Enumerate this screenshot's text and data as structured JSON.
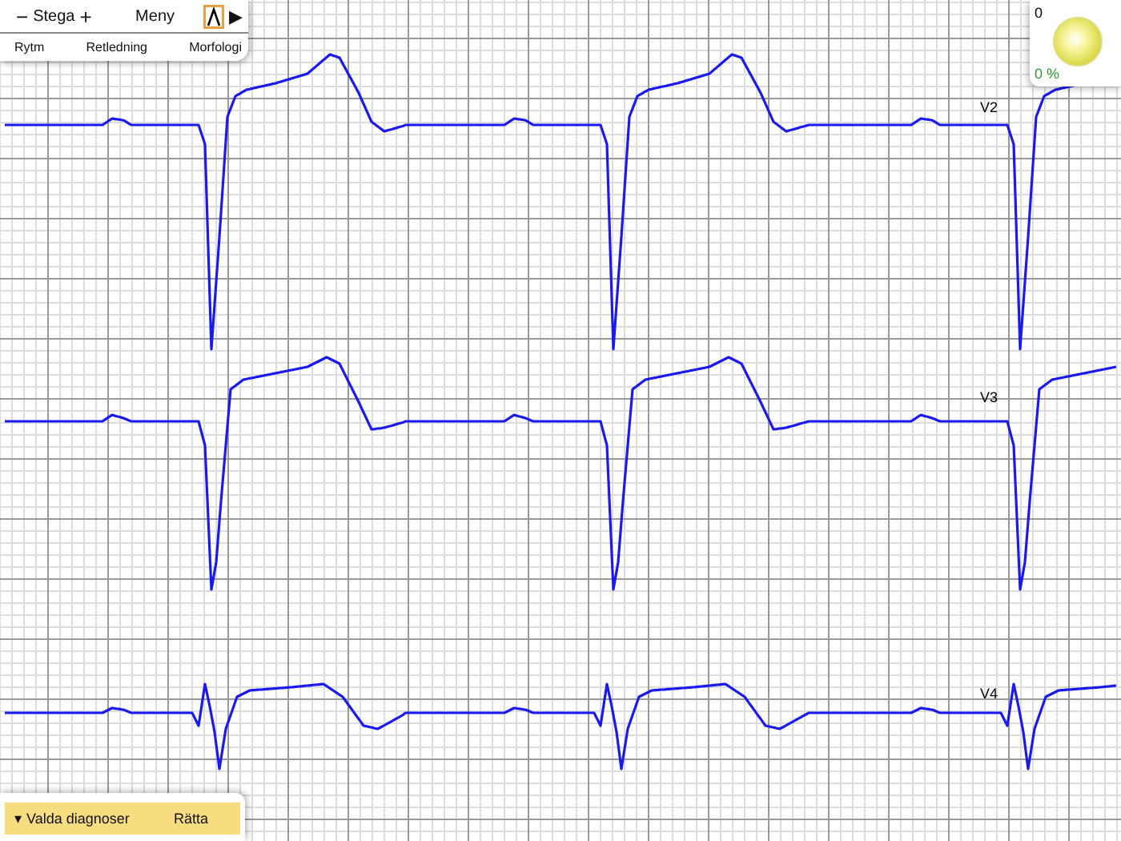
{
  "toolbar": {
    "step_minus": "−",
    "step_label": "Stega",
    "step_plus": "+",
    "menu": "Meny",
    "play": "▶",
    "tabs": [
      {
        "label": "Rytm"
      },
      {
        "label": "Retledning"
      },
      {
        "label": "Morfologi"
      }
    ]
  },
  "score": {
    "count": "0",
    "percent": "0 %"
  },
  "leads": [
    {
      "label": "V2"
    },
    {
      "label": "V3"
    },
    {
      "label": "V4"
    }
  ],
  "bottom_bar": {
    "caret": "▾",
    "label": "Valda diagnoser",
    "action": "Rätta"
  }
}
